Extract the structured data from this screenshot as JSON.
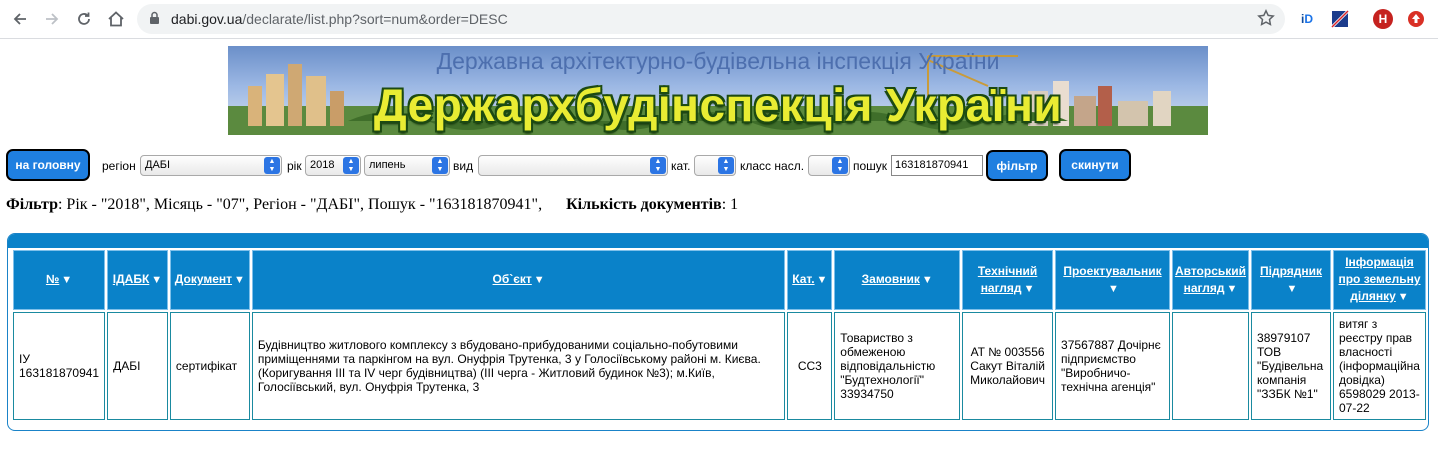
{
  "browser": {
    "url_host": "dabi.gov.ua",
    "url_path": "/declarate/list.php?sort=num&order=DESC",
    "ext_profile_letter": "H"
  },
  "banner": {
    "subtitle": "Державна архітектурно-будівельна інспекція України",
    "title": "Держархбудінспекція України"
  },
  "filters": {
    "home_button": "на головну",
    "region_label": "регіон",
    "region_value": "ДАБІ",
    "year_label": "рік",
    "year_value": "2018",
    "month_value": "липень",
    "type_label": "вид",
    "type_value": "",
    "cat_label": "кат.",
    "cat_value": "",
    "class_label": "класс насл.",
    "class_value": "",
    "search_label": "пошук",
    "search_value": "163181870941",
    "filter_button": "фільтр",
    "reset_button": "скинути"
  },
  "summary": {
    "filter_label": "Фільтр",
    "filter_text": ": Рік - \"2018\", Місяць - \"07\", Регіон - \"ДАБІ\", Пошук - \"163181870941\",",
    "count_label": "Кількість документів",
    "count_value": ": 1"
  },
  "table": {
    "headers": [
      {
        "l1": "№",
        "l2": ""
      },
      {
        "l1": "ІДАБК",
        "l2": ""
      },
      {
        "l1": "Документ",
        "l2": ""
      },
      {
        "l1": "Об`єкт",
        "l2": ""
      },
      {
        "l1": "Кат.",
        "l2": ""
      },
      {
        "l1": "Замовник",
        "l2": ""
      },
      {
        "l1": "Технічний",
        "l2": "нагляд"
      },
      {
        "l1": "Проектувальник",
        "l2": ""
      },
      {
        "l1": "Авторський",
        "l2": "нагляд"
      },
      {
        "l1": "Підрядник",
        "l2": ""
      },
      {
        "l1": "Інформація",
        "l2": "про земельну",
        "l3": "ділянку"
      }
    ],
    "rows": [
      {
        "num": "ІУ 163181870941",
        "idabk": "ДАБІ",
        "doc": "сертифікат",
        "object": "Будівництво житлового комплексу з вбудовано-прибудованими соціально-побутовими приміщеннями та паркінгом на вул. Онуфрія Трутенка, 3 у Голосіївському районі м. Києва. (Коригування ІІІ та IV черг будівництва) (ІІІ черга - Житловий будинок №3); м.Київ, Голосіївський, вул. Онуфрія Трутенка, 3",
        "cat": "СС3",
        "customer": "Товариство з обмеженою відповідальністю \"Будтехнології\" 33934750",
        "tech": "АТ № 003556 Сакут Віталій Миколайович",
        "designer": "37567887 Дочірнє підприємство \"Виробничо-технічна агенція\"",
        "author": "",
        "contractor": "38979107 ТОВ \"Будівельна компанія \"ЗЗБК №1\"",
        "land": "витяг з реєстру прав власності (інформаційна довідка) 6598029 2013-07-22"
      }
    ]
  }
}
